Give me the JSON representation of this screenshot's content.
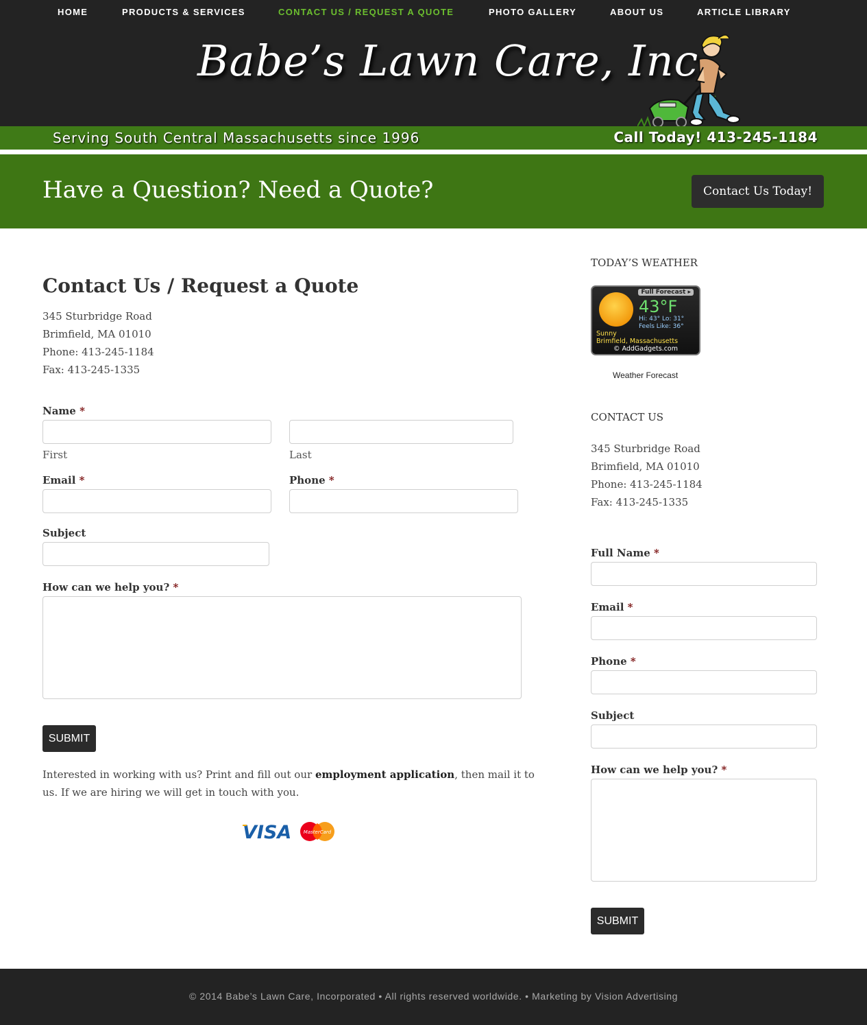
{
  "nav": {
    "items": [
      {
        "label": "HOME"
      },
      {
        "label": "PRODUCTS & SERVICES"
      },
      {
        "label": "CONTACT US / REQUEST A QUOTE"
      },
      {
        "label": "PHOTO GALLERY"
      },
      {
        "label": "ABOUT US"
      },
      {
        "label": "ARTICLE LIBRARY"
      }
    ],
    "active_color": "#6cbf2f"
  },
  "header": {
    "logo_text": "Babe’s Lawn Care, Inc.",
    "tagline": "Serving South Central Massachusetts since 1996",
    "call_today": "Call Today! 413-245-1184"
  },
  "banner": {
    "title": "Have a Question? Need a Quote?",
    "button_label": "Contact Us Today!"
  },
  "main": {
    "title": "Contact Us / Request a Quote",
    "address": {
      "street": "345 Sturbridge Road",
      "city": "Brimfield, MA 01010",
      "phone": "Phone:  413-245-1184",
      "fax": "Fax:  413-245-1335"
    },
    "form": {
      "name_label": "Name",
      "first_label": "First",
      "last_label": "Last",
      "email_label": "Email",
      "phone_label": "Phone",
      "subject_label": "Subject",
      "message_label": "How can we help you?",
      "required_mark": "*",
      "submit_label": "SUBMIT"
    },
    "employment": {
      "before": "Interested in working with us? Print and fill out our ",
      "link": "employment application",
      "after": ", then mail it to us. If we are hiring we will get in touch with you."
    },
    "cards": {
      "visa": "VISA",
      "mastercard": "MasterCard"
    }
  },
  "sidebar": {
    "weather_heading": "TODAY’S WEATHER",
    "weather": {
      "full_forecast": "Full Forecast ▸",
      "temp": "43°F",
      "hilo": "Hi: 43°   Lo: 31°",
      "feels": "Feels Like: 36°",
      "condition": "Sunny",
      "location": "Brimfield, Massachusetts",
      "credit": "© AddGadgets.com"
    },
    "weather_link": "Weather Forecast",
    "contact_heading": "CONTACT US",
    "address": {
      "street": "345 Sturbridge Road",
      "city": "Brimfield, MA 01010",
      "phone": "Phone: 413-245-1184",
      "fax": "Fax: 413-245-1335"
    },
    "form": {
      "fullname_label": "Full Name",
      "email_label": "Email",
      "phone_label": "Phone",
      "subject_label": "Subject",
      "message_label": "How can we help you?",
      "required_mark": "*",
      "submit_label": "SUBMIT"
    }
  },
  "footer": {
    "text": "© 2014 Babe’s Lawn Care, Incorporated • All rights reserved worldwide. • Marketing by Vision Advertising"
  },
  "colors": {
    "header_bg": "#232323",
    "green": "#3e7614",
    "button_dark": "#2d2d2d"
  }
}
